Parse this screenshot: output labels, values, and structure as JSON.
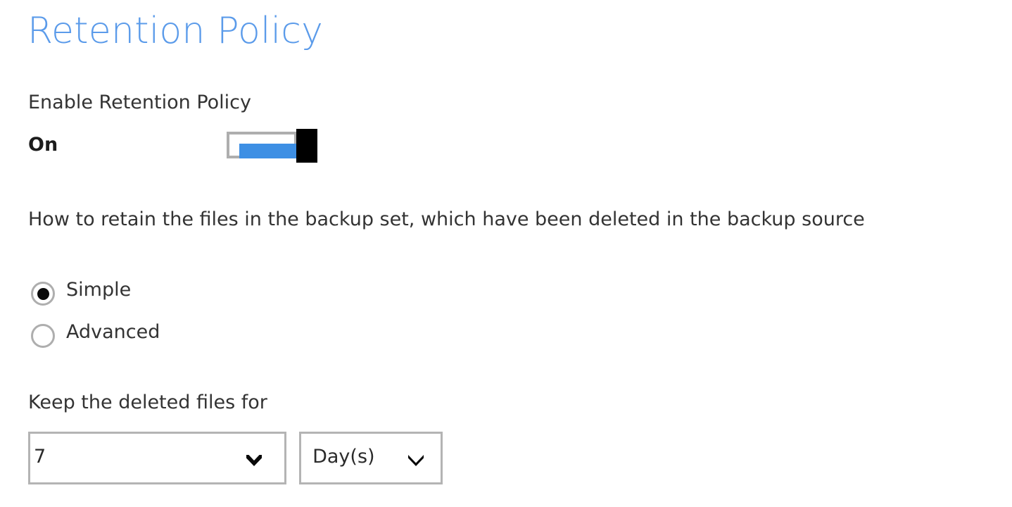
{
  "page": {
    "title": "Retention Policy"
  },
  "enable_section": {
    "label": "Enable Retention Policy",
    "toggle": {
      "state_label": "On",
      "checked": true,
      "track_color": "#3d8fe4",
      "thumb_color": "#000000",
      "border_color": "#aeaeae"
    }
  },
  "retention_mode": {
    "description": "How to retain the files in the backup set, which have been deleted in the backup source",
    "options": [
      {
        "label": "Simple",
        "selected": true
      },
      {
        "label": "Advanced",
        "selected": false
      }
    ]
  },
  "keep_deleted": {
    "label": "Keep the deleted files for",
    "duration": {
      "value": "7",
      "icon": "chevron-down-icon"
    },
    "unit": {
      "value": "Day(s)",
      "icon": "chevron-down-icon"
    }
  },
  "colors": {
    "title_blue": "#5b9bea",
    "body_text": "#333333",
    "border_gray": "#b4b4b4",
    "accent_blue": "#3d8fe4"
  }
}
